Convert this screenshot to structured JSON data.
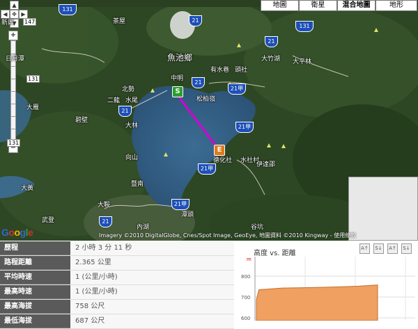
{
  "map": {
    "map_types": [
      {
        "label": "地圖",
        "active": false
      },
      {
        "label": "衛星",
        "active": false
      },
      {
        "label": "混合地圖",
        "active": true
      },
      {
        "label": "地形",
        "active": false
      }
    ],
    "nav_icons": [
      "pan-up-icon",
      "pan-left-icon",
      "center-icon",
      "pan-right-icon",
      "pan-down-icon"
    ],
    "zoom": {
      "in_label": "+",
      "out_label": "−"
    },
    "zoom_labels": [
      {
        "text": "147"
      },
      {
        "text": "131"
      },
      {
        "text": "131"
      }
    ],
    "place_labels": [
      "新興",
      "日月潭",
      "魚池鄉",
      "中明",
      "北勢",
      "二龍",
      "水尾",
      "松柏嶺",
      "有水巷",
      "頭社",
      "大雁",
      "碧壁",
      "大林",
      "向山",
      "德化社",
      "暨南",
      "內湖",
      "武登",
      "潭頭",
      "水社村",
      "伊達邵",
      "大竹湖",
      "大平林",
      "大鞍",
      "大黃",
      "谷坑",
      "茶屋"
    ],
    "shields": [
      "131",
      "21",
      "21",
      "21",
      "21",
      "21甲",
      "21甲",
      "21甲",
      "21甲",
      "21",
      "131"
    ],
    "start_marker": "S",
    "end_marker": "E",
    "attribution": "Imagery ©2010 DigitalGlobe, Cnes/Spot Image, GeoEye, 地圖資料 ©2010 Kingway - 使用條款",
    "logo": "Google"
  },
  "stats": [
    {
      "label": "歷程",
      "value": "2 小時 3 分 11 秒"
    },
    {
      "label": "路程距離",
      "value": "2.365 公里"
    },
    {
      "label": "平均時速",
      "value": "1 (公里/小時)"
    },
    {
      "label": "最高時速",
      "value": "1 (公里/小時)"
    },
    {
      "label": "最高海拔",
      "value": "758 公尺"
    },
    {
      "label": "最低海拔",
      "value": "687 公尺"
    }
  ],
  "chart_panel": {
    "title": "高度 vs. 距離",
    "unit": "m",
    "buttons": [
      "A↑",
      "S↓",
      "A↑",
      "S↓"
    ]
  },
  "chart_data": {
    "type": "area",
    "title": "高度 vs. 距離",
    "ylabel": "m",
    "yticks": [
      900,
      800,
      700,
      600
    ],
    "ylim": [
      600,
      1000
    ],
    "series": [
      {
        "x": [
          0,
          0.05,
          0.5,
          1.0,
          1.5,
          2.0,
          2.365
        ],
        "y": [
          687,
          735,
          743,
          745,
          748,
          752,
          758
        ]
      }
    ],
    "fill_color": "#f0a060",
    "grid": true
  }
}
